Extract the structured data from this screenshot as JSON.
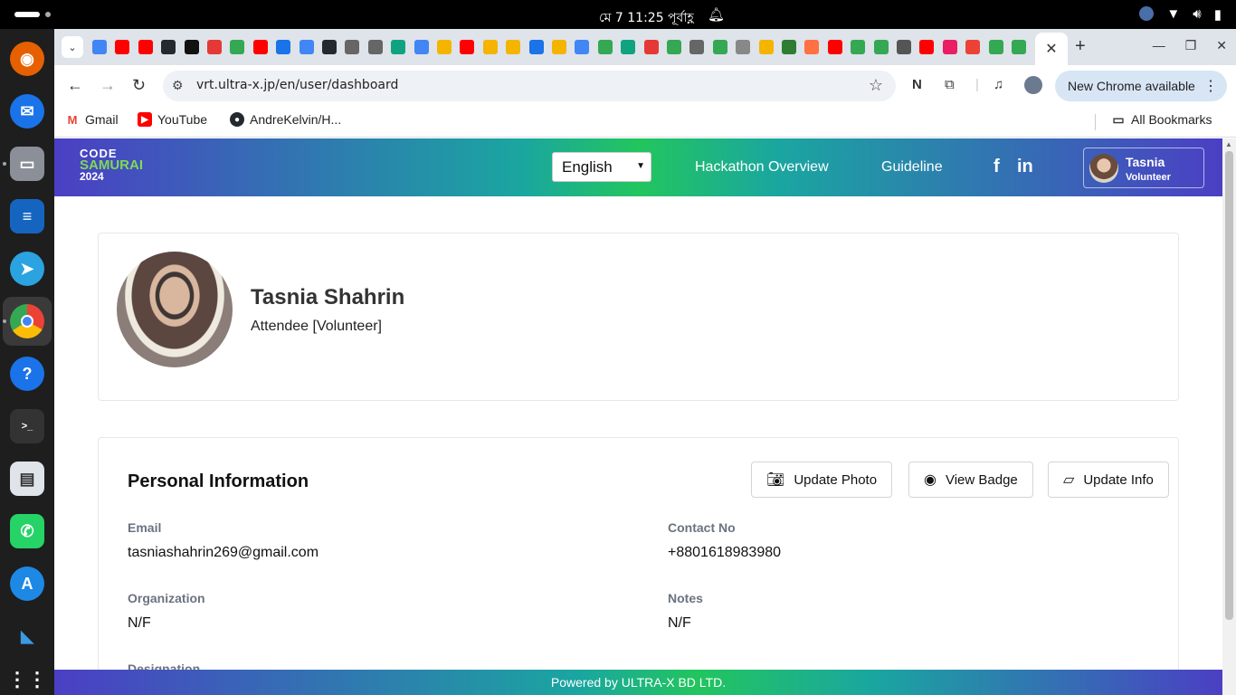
{
  "system": {
    "clock": "মে 7  11:25 পূর্বাহ্ণ"
  },
  "dock": {
    "apps": [
      "firefox-icon",
      "thunderbird-icon",
      "files-icon",
      "writer-icon",
      "telegram-icon",
      "chrome-icon",
      "help-icon",
      "terminal-icon",
      "document-viewer-icon",
      "whatsapp-icon",
      "app-store-icon",
      "vscode-icon",
      "app-grid-icon"
    ]
  },
  "browser": {
    "url": "vrt.ultra-x.jp/en/user/dashboard",
    "new_chrome_label": "New Chrome available",
    "bookmarks": [
      "Gmail",
      "YouTube",
      "AndreKelvin/H..."
    ],
    "all_bookmarks_label": "All Bookmarks"
  },
  "site": {
    "logo": {
      "line1": "CODE",
      "line2": "SAMURAI",
      "line3": "2024"
    },
    "language": "English",
    "nav": [
      "Hackathon Overview",
      "Guideline"
    ],
    "user": {
      "name": "Tasnia",
      "role": "Volunteer"
    },
    "footer": "Powered by ULTRA-X BD LTD."
  },
  "profile": {
    "name": "Tasnia  Shahrin",
    "role": "Attendee [Volunteer]"
  },
  "personal_info": {
    "title": "Personal Information",
    "buttons": {
      "update_photo": "Update Photo",
      "view_badge": "View Badge",
      "update_info": "Update Info"
    },
    "fields": {
      "email_label": "Email",
      "email_value": "tasniashahrin269@gmail.com",
      "contact_label": "Contact No",
      "contact_value": "+8801618983980",
      "org_label": "Organization",
      "org_value": "N/F",
      "notes_label": "Notes",
      "notes_value": "N/F",
      "designation_label": "Designation"
    }
  }
}
